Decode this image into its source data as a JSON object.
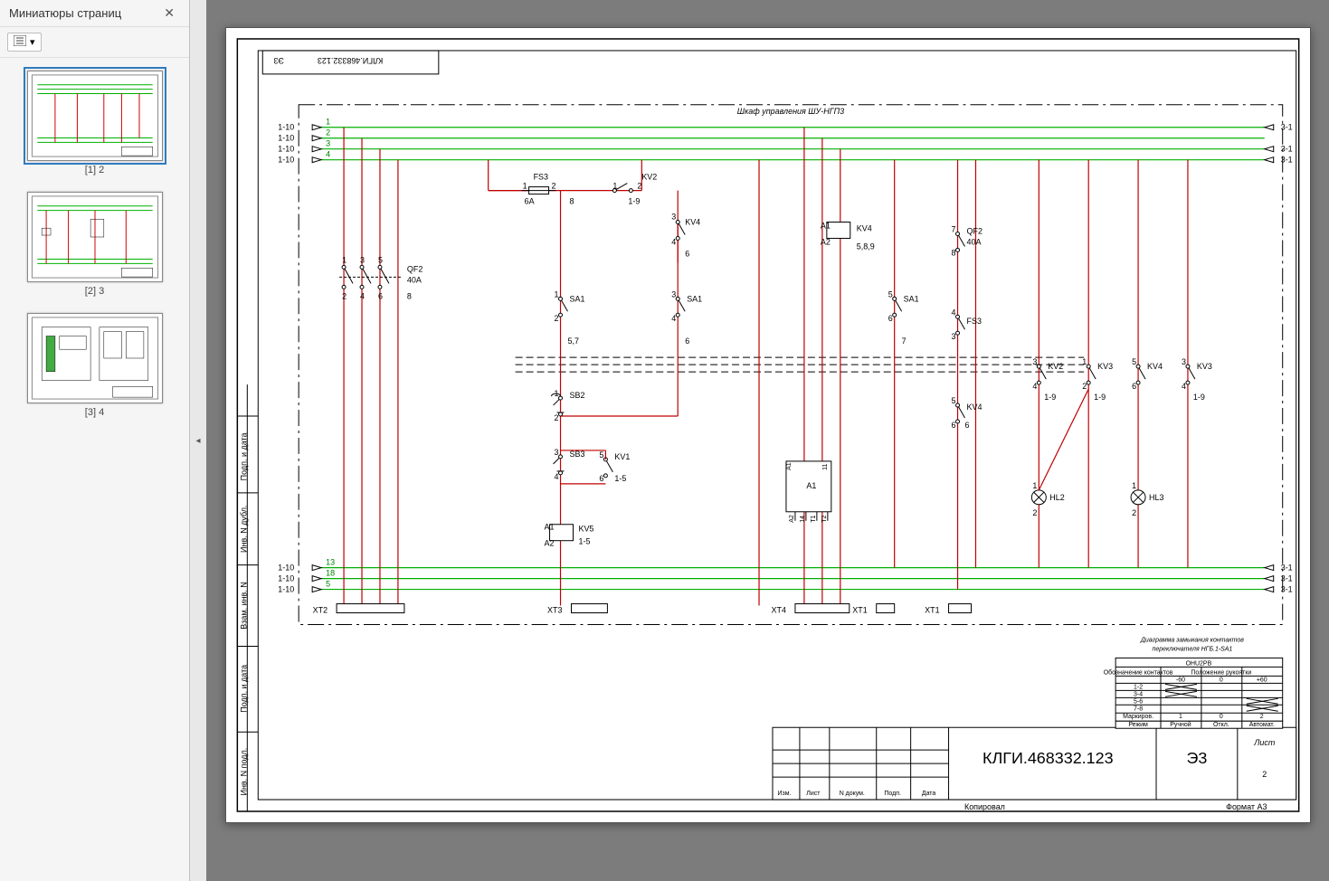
{
  "sidebar": {
    "title": "Миниатюры страниц",
    "thumbs": [
      {
        "label": "[1] 2",
        "selected": true
      },
      {
        "label": "[2] 3",
        "selected": false
      },
      {
        "label": "[3] 4",
        "selected": false
      }
    ]
  },
  "drawing": {
    "doc_number_top": "КЛГИ.468332.123",
    "doc_type_top": "Э3",
    "cabinet_title": "Шкаф управления ШУ-НГП3",
    "doc_number": "КЛГИ.468332.123",
    "doc_type": "Э3",
    "sheet_label": "Лист",
    "sheet_no": "2",
    "format": "Формат А3",
    "copy": "Копировал",
    "legend_cols": [
      "Изм.",
      "Лист",
      "N докум.",
      "Подп.",
      "Дата"
    ],
    "side_cols": [
      "Подп. и дата",
      "Инв. N дубл.",
      "Взам. инв. N",
      "Подп. и дата",
      "Инв. N подл."
    ],
    "diagram_note1": "Диаграмма замыкания контактов",
    "diagram_note2": "переключателя НГБ.1-SA1",
    "table_hdr1": "ОНU2РВ",
    "table_hdr2a": "Обозначение контактов",
    "table_hdr2b": "Положение рукоятки",
    "table_pos": [
      "-60",
      "0",
      "+60"
    ],
    "table_rows": [
      "1-2",
      "3-4",
      "5-6",
      "7-8"
    ],
    "table_footer": [
      "Маркиров.",
      "1",
      "0",
      "2"
    ],
    "table_footer2": [
      "Режим",
      "Ручной",
      "Откл.",
      "Автомат."
    ],
    "bus_left": [
      "1-10",
      "1-10",
      "1-10",
      "1-10"
    ],
    "bus_left_bot": [
      "1-10",
      "1-10",
      "1-10"
    ],
    "bus_right": [
      "3-1",
      "3-1",
      "3-1"
    ],
    "bus_right_bot": [
      "3-1",
      "3-1",
      "3-1"
    ],
    "wire_no_top": [
      "1",
      "2",
      "3",
      "4"
    ],
    "wire_no_bot": [
      "13",
      "18",
      "5"
    ],
    "terminals": {
      "XT2": "XT2",
      "XT3": "XT3",
      "XT4": "XT4",
      "XT1a": "XT1",
      "XT1b": "XT1"
    },
    "comp": {
      "QF2": "QF2",
      "QF2A": "40A",
      "QF2B": "8",
      "FS3": "FS3",
      "FS3A": "6A",
      "KV2": "KV2",
      "KV2A": "1-9",
      "KV4": "KV4",
      "KV4A": "5,8,9",
      "SA1": "SA1",
      "SB2": "SB2",
      "SB3": "SB3",
      "KV1": "KV1",
      "KV1A": "1-5",
      "KV5": "KV5",
      "KV5A": "1-5",
      "A1": "A1",
      "QF2r": "QF2",
      "QF2rA": "40A",
      "FS3r": "FS3",
      "KV4r": "KV4",
      "HL2": "HL2",
      "HL3": "HL3",
      "KV2c": "KV2",
      "KV3c": "KV3",
      "KV4c": "KV4",
      "KV3c2": "KV3",
      "c19": "1-9"
    }
  }
}
